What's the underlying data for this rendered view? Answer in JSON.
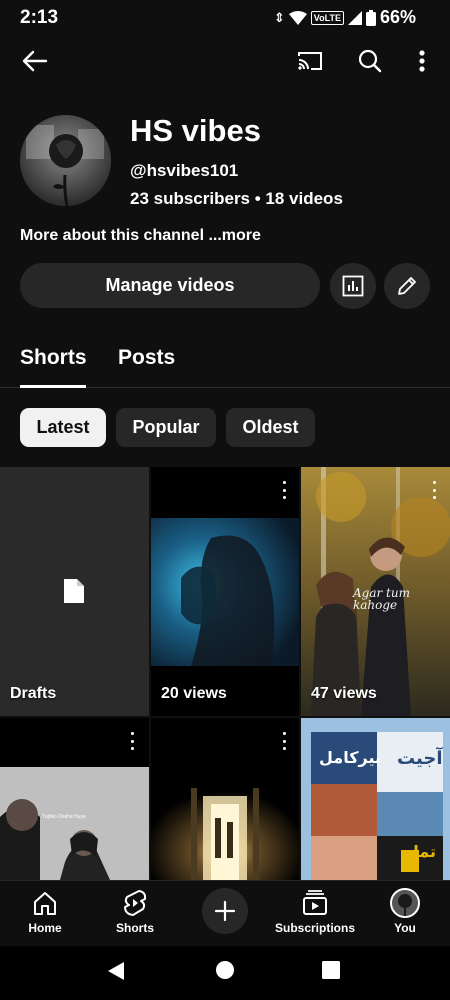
{
  "status_bar": {
    "time": "2:13",
    "network": "VoLTE",
    "battery": "66%"
  },
  "app_bar": {
    "back_icon": "arrow-left-icon",
    "cast_icon": "cast-icon",
    "search_icon": "search-icon",
    "menu_icon": "more-vertical-icon"
  },
  "channel": {
    "title": "HS vibes",
    "handle": "@hsvibes101",
    "stats": "23 subscribers • 18 videos",
    "about": "More about this channel ...more",
    "manage_label": "Manage videos",
    "analytics_icon": "analytics-icon",
    "edit_icon": "pencil-icon"
  },
  "tabs": [
    {
      "label": "Shorts",
      "active": true
    },
    {
      "label": "Posts",
      "active": false
    }
  ],
  "chips": [
    {
      "label": "Latest",
      "active": true
    },
    {
      "label": "Popular",
      "active": false
    },
    {
      "label": "Oldest",
      "active": false
    }
  ],
  "grid": [
    {
      "label": "Drafts",
      "icon": "file-icon"
    },
    {
      "label": "20 views"
    },
    {
      "label": "47 views",
      "overlay_text": "Agar tum kahoge"
    },
    {
      "label": "",
      "overlay_text": "Tujhko Dekhe Huye"
    },
    {
      "label": ""
    },
    {
      "label": "",
      "overlay_text": [
        "آجیت",
        "بیرکامل",
        "تمل"
      ]
    }
  ],
  "bottom_nav": [
    {
      "label": "Home",
      "icon": "home-icon"
    },
    {
      "label": "Shorts",
      "icon": "shorts-icon"
    },
    {
      "label": "",
      "icon": "plus-icon"
    },
    {
      "label": "Subscriptions",
      "icon": "subscriptions-icon"
    },
    {
      "label": "You",
      "icon": "avatar-icon"
    }
  ],
  "colors": {
    "background": "#0f0f0f",
    "surface": "#272727",
    "text": "#ffffff",
    "chip_active": "#f1f1f1"
  }
}
